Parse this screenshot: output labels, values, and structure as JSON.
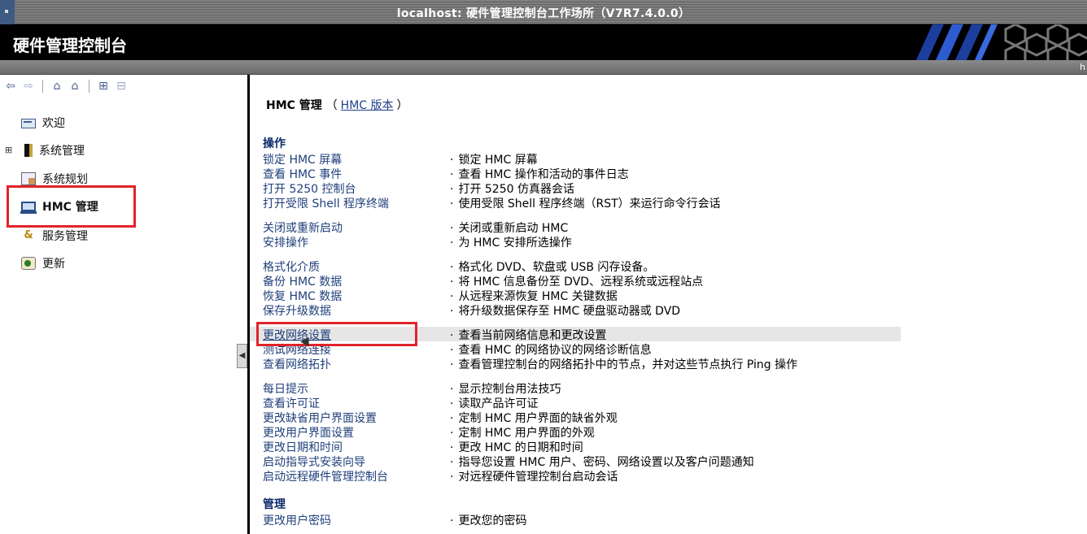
{
  "window": {
    "title": "localhost: 硬件管理控制台工作场所（V7R7.4.0.0）"
  },
  "app": {
    "title": "硬件管理控制台",
    "user_hint": "h"
  },
  "nav": {
    "items": [
      {
        "label": "欢迎",
        "icon": "welcome-icon"
      },
      {
        "label": "系统管理",
        "icon": "systems-management-icon",
        "expandable": true
      },
      {
        "label": "系统规划",
        "icon": "system-plans-icon"
      },
      {
        "label": "HMC 管理",
        "icon": "hmc-management-icon",
        "selected": true
      },
      {
        "label": "服务管理",
        "icon": "service-management-icon"
      },
      {
        "label": "更新",
        "icon": "updates-icon"
      }
    ]
  },
  "content": {
    "heading": "HMC 管理",
    "heading_link": "HMC 版本",
    "paren_open": "（",
    "paren_close": "）",
    "sections": [
      {
        "title": "操作"
      },
      {
        "title": "管理"
      }
    ],
    "tasks": [
      {
        "name": "锁定 HMC 屏幕",
        "desc": "锁定 HMC 屏幕"
      },
      {
        "name": "查看 HMC 事件",
        "desc": "查看 HMC 操作和活动的事件日志"
      },
      {
        "name": "打开 5250 控制台",
        "desc": "打开 5250 仿真器会话"
      },
      {
        "name": "打开受限 Shell 程序终端",
        "desc": "使用受限 Shell 程序终端（RST）来运行命令行会话"
      },
      {
        "name": "关闭或重新启动",
        "desc": "关闭或重新启动 HMC"
      },
      {
        "name": "安排操作",
        "desc": "为 HMC 安排所选操作"
      },
      {
        "name": "格式化介质",
        "desc": "格式化 DVD、软盘或 USB 闪存设备。"
      },
      {
        "name": "备份 HMC 数据",
        "desc": "将 HMC 信息备份至 DVD、远程系统或远程站点"
      },
      {
        "name": "恢复 HMC 数据",
        "desc": "从远程来源恢复 HMC 关键数据"
      },
      {
        "name": "保存升级数据",
        "desc": "将升级数据保存至 HMC 硬盘驱动器或 DVD"
      },
      {
        "name": "更改网络设置",
        "desc": "查看当前网络信息和更改设置"
      },
      {
        "name": "测试网络连接",
        "desc": "查看 HMC 的网络协议的网络诊断信息"
      },
      {
        "name": "查看网络拓扑",
        "desc": "查看管理控制台的网络拓扑中的节点，并对这些节点执行 Ping 操作"
      },
      {
        "name": "每日提示",
        "desc": "显示控制台用法技巧"
      },
      {
        "name": "查看许可证",
        "desc": "读取产品许可证"
      },
      {
        "name": "更改缺省用户界面设置",
        "desc": "定制 HMC 用户界面的缺省外观"
      },
      {
        "name": "更改用户界面设置",
        "desc": "定制 HMC 用户界面的外观"
      },
      {
        "name": "更改日期和时间",
        "desc": "更改 HMC 的日期和时间"
      },
      {
        "name": "启动指导式安装向导",
        "desc": "指导您设置 HMC 用户、密码、网络设置以及客户问题通知"
      },
      {
        "name": "启动远程硬件管理控制台",
        "desc": "对远程硬件管理控制台启动会话"
      },
      {
        "name": "更改用户密码",
        "desc": "更改您的密码"
      }
    ]
  }
}
